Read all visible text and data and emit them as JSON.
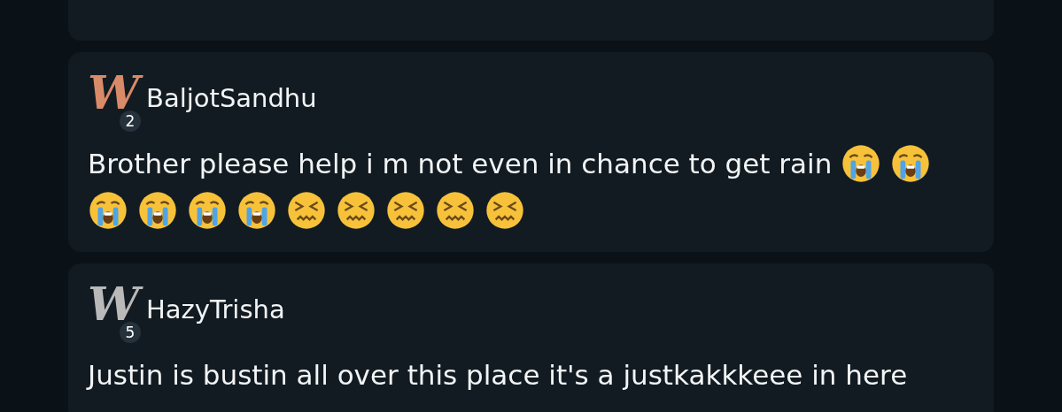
{
  "comments": [
    {
      "author": "BaljotSandhu",
      "logo": "W",
      "color": "#d98a68",
      "level": "2",
      "text": "Brother please help i m not even in chance to get rain",
      "emojis": [
        {
          "kind": "crying"
        },
        {
          "kind": "crying"
        },
        {
          "kind": "crying"
        },
        {
          "kind": "crying"
        },
        {
          "kind": "crying"
        },
        {
          "kind": "crying"
        },
        {
          "kind": "tired"
        },
        {
          "kind": "tired"
        },
        {
          "kind": "tired"
        },
        {
          "kind": "tired"
        },
        {
          "kind": "tired"
        }
      ]
    },
    {
      "author": "HazyTrisha",
      "logo": "W",
      "color": "#b9b9b9",
      "level": "5",
      "text": "Justin is bustin all over this place it's a justkakkkeee in here"
    }
  ]
}
